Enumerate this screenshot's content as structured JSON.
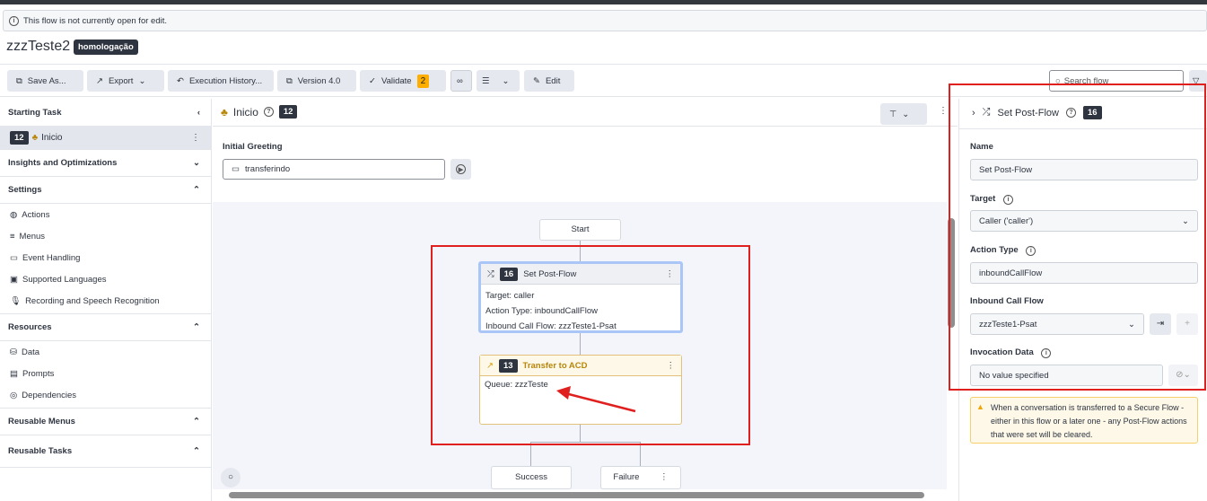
{
  "banner": {
    "text": "This flow is not currently open for edit."
  },
  "flow": {
    "title": "zzzTeste2",
    "tag": "homologação"
  },
  "toolbar": {
    "save_as": "Save As...",
    "export": "Export",
    "execution_history": "Execution History...",
    "version": "Version 4.0",
    "validate": "Validate",
    "validate_count": "2",
    "edit": "Edit",
    "search_placeholder": "Search flow"
  },
  "sidebar": {
    "starting_task": "Starting Task",
    "task_num": "12",
    "task_name": "Inicio",
    "insights": "Insights and Optimizations",
    "settings": "Settings",
    "settings_items": [
      "Actions",
      "Menus",
      "Event Handling",
      "Supported Languages",
      "Recording and Speech Recognition"
    ],
    "resources": "Resources",
    "resources_items": [
      "Data",
      "Prompts",
      "Dependencies"
    ],
    "reusable_menus": "Reusable Menus",
    "reusable_tasks": "Reusable Tasks"
  },
  "center": {
    "title": "Inicio",
    "num": "12",
    "greeting_label": "Initial Greeting",
    "greeting_value": "transferindo"
  },
  "canvas": {
    "start": "Start",
    "set_post_flow": {
      "num": "16",
      "title": "Set Post-Flow",
      "lines": [
        "Target: caller",
        "Action Type: inboundCallFlow",
        "Inbound Call Flow: zzzTeste1-Psat"
      ]
    },
    "transfer": {
      "num": "13",
      "title": "Transfer to ACD",
      "lines": [
        "Queue: zzzTeste"
      ]
    },
    "success": "Success",
    "failure": "Failure"
  },
  "panel": {
    "title": "Set Post-Flow",
    "num": "16",
    "name_label": "Name",
    "name_value": "Set Post-Flow",
    "target_label": "Target",
    "target_value": "Caller ('caller')",
    "action_type_label": "Action Type",
    "action_type_value": "inboundCallFlow",
    "inbound_label": "Inbound Call Flow",
    "inbound_value": "zzzTeste1-Psat",
    "invocation_label": "Invocation Data",
    "invocation_value": "No value specified",
    "warning": "When a conversation is transferred to a Secure Flow - either in this flow or a later one - any Post-Flow actions that were set will be cleared."
  },
  "colors": {
    "annotation": "#e0201e",
    "warning_bg": "#fdf8e8",
    "transfer_accent": "#b8860b",
    "selected_border": "#8fb4f5"
  }
}
